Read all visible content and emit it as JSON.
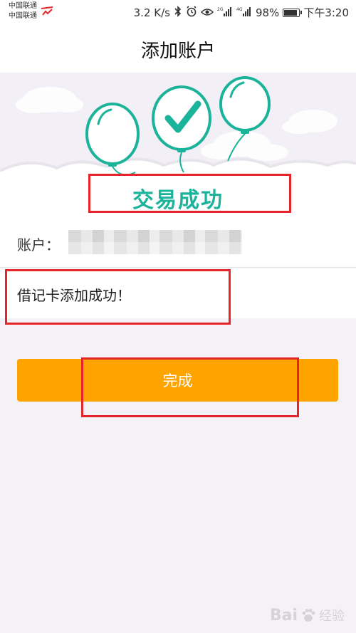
{
  "status_bar": {
    "carrier_1": "中国联通",
    "carrier_2": "中国联通",
    "net_speed": "3.2 K/s",
    "sig_2g": "2G",
    "sig_4g": "4G",
    "battery": "98%",
    "time": "下午3:20"
  },
  "header": {
    "title": "添加账户"
  },
  "hero": {
    "status_text": "交易成功"
  },
  "account": {
    "label": "账户："
  },
  "message": {
    "text": "借记卡添加成功！"
  },
  "done_button": {
    "label": "完成"
  },
  "watermark": {
    "text": "Bai",
    "sub": "经验"
  },
  "colors": {
    "accent": "#fea400",
    "success": "#1bb39a",
    "highlight": "#e5252a"
  }
}
